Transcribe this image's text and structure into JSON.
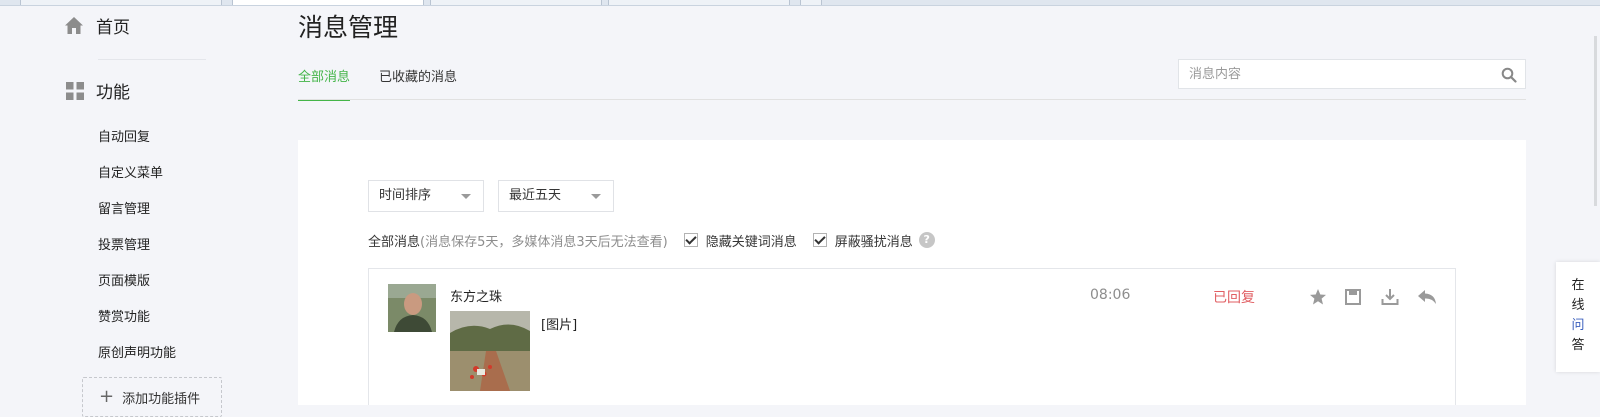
{
  "sidebar": {
    "home_label": "首页",
    "function_label": "功能",
    "items": [
      "自动回复",
      "自定义菜单",
      "留言管理",
      "投票管理",
      "页面模版",
      "赞赏功能",
      "原创声明功能"
    ],
    "add_plugin_label": "添加功能插件"
  },
  "main": {
    "title": "消息管理",
    "tabs": [
      {
        "label": "全部消息",
        "active": true
      },
      {
        "label": "已收藏的消息",
        "active": false
      }
    ],
    "search": {
      "placeholder": "消息内容",
      "icon": "search-icon"
    },
    "sort_select": "时间排序",
    "range_select": "最近五天",
    "filter": {
      "label": "全部消息",
      "note": "(消息保存5天，多媒体消息3天后无法查看)",
      "hide_keyword_label": "隐藏关键词消息",
      "hide_keyword_checked": true,
      "block_spam_label": "屏蔽骚扰消息",
      "block_spam_checked": true,
      "help_icon": "?"
    },
    "messages": [
      {
        "sender": "东方之珠",
        "content": "[图片]",
        "time": "08:06",
        "status": "已回复",
        "actions": [
          "star-icon",
          "save-icon",
          "download-icon",
          "reply-icon"
        ]
      }
    ]
  },
  "online_qa": {
    "chars": [
      "在",
      "线",
      "问",
      "答"
    ]
  },
  "colors": {
    "accent": "#44b549",
    "replied": "#e15f63",
    "background": "#f4f5f9"
  }
}
